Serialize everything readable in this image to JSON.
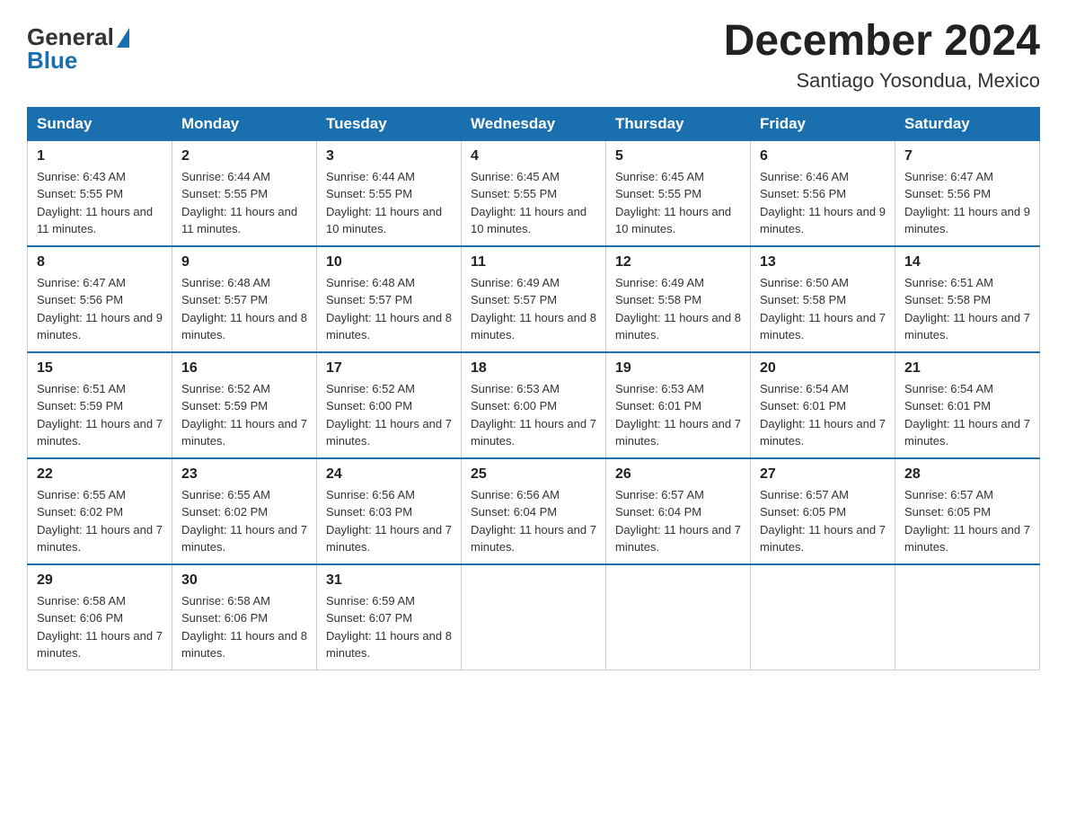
{
  "header": {
    "logo_general": "General",
    "logo_blue": "Blue",
    "month_title": "December 2024",
    "location": "Santiago Yosondua, Mexico"
  },
  "weekdays": [
    "Sunday",
    "Monday",
    "Tuesday",
    "Wednesday",
    "Thursday",
    "Friday",
    "Saturday"
  ],
  "weeks": [
    [
      {
        "day": "1",
        "sunrise": "6:43 AM",
        "sunset": "5:55 PM",
        "daylight": "11 hours and 11 minutes."
      },
      {
        "day": "2",
        "sunrise": "6:44 AM",
        "sunset": "5:55 PM",
        "daylight": "11 hours and 11 minutes."
      },
      {
        "day": "3",
        "sunrise": "6:44 AM",
        "sunset": "5:55 PM",
        "daylight": "11 hours and 10 minutes."
      },
      {
        "day": "4",
        "sunrise": "6:45 AM",
        "sunset": "5:55 PM",
        "daylight": "11 hours and 10 minutes."
      },
      {
        "day": "5",
        "sunrise": "6:45 AM",
        "sunset": "5:55 PM",
        "daylight": "11 hours and 10 minutes."
      },
      {
        "day": "6",
        "sunrise": "6:46 AM",
        "sunset": "5:56 PM",
        "daylight": "11 hours and 9 minutes."
      },
      {
        "day": "7",
        "sunrise": "6:47 AM",
        "sunset": "5:56 PM",
        "daylight": "11 hours and 9 minutes."
      }
    ],
    [
      {
        "day": "8",
        "sunrise": "6:47 AM",
        "sunset": "5:56 PM",
        "daylight": "11 hours and 9 minutes."
      },
      {
        "day": "9",
        "sunrise": "6:48 AM",
        "sunset": "5:57 PM",
        "daylight": "11 hours and 8 minutes."
      },
      {
        "day": "10",
        "sunrise": "6:48 AM",
        "sunset": "5:57 PM",
        "daylight": "11 hours and 8 minutes."
      },
      {
        "day": "11",
        "sunrise": "6:49 AM",
        "sunset": "5:57 PM",
        "daylight": "11 hours and 8 minutes."
      },
      {
        "day": "12",
        "sunrise": "6:49 AM",
        "sunset": "5:58 PM",
        "daylight": "11 hours and 8 minutes."
      },
      {
        "day": "13",
        "sunrise": "6:50 AM",
        "sunset": "5:58 PM",
        "daylight": "11 hours and 7 minutes."
      },
      {
        "day": "14",
        "sunrise": "6:51 AM",
        "sunset": "5:58 PM",
        "daylight": "11 hours and 7 minutes."
      }
    ],
    [
      {
        "day": "15",
        "sunrise": "6:51 AM",
        "sunset": "5:59 PM",
        "daylight": "11 hours and 7 minutes."
      },
      {
        "day": "16",
        "sunrise": "6:52 AM",
        "sunset": "5:59 PM",
        "daylight": "11 hours and 7 minutes."
      },
      {
        "day": "17",
        "sunrise": "6:52 AM",
        "sunset": "6:00 PM",
        "daylight": "11 hours and 7 minutes."
      },
      {
        "day": "18",
        "sunrise": "6:53 AM",
        "sunset": "6:00 PM",
        "daylight": "11 hours and 7 minutes."
      },
      {
        "day": "19",
        "sunrise": "6:53 AM",
        "sunset": "6:01 PM",
        "daylight": "11 hours and 7 minutes."
      },
      {
        "day": "20",
        "sunrise": "6:54 AM",
        "sunset": "6:01 PM",
        "daylight": "11 hours and 7 minutes."
      },
      {
        "day": "21",
        "sunrise": "6:54 AM",
        "sunset": "6:01 PM",
        "daylight": "11 hours and 7 minutes."
      }
    ],
    [
      {
        "day": "22",
        "sunrise": "6:55 AM",
        "sunset": "6:02 PM",
        "daylight": "11 hours and 7 minutes."
      },
      {
        "day": "23",
        "sunrise": "6:55 AM",
        "sunset": "6:02 PM",
        "daylight": "11 hours and 7 minutes."
      },
      {
        "day": "24",
        "sunrise": "6:56 AM",
        "sunset": "6:03 PM",
        "daylight": "11 hours and 7 minutes."
      },
      {
        "day": "25",
        "sunrise": "6:56 AM",
        "sunset": "6:04 PM",
        "daylight": "11 hours and 7 minutes."
      },
      {
        "day": "26",
        "sunrise": "6:57 AM",
        "sunset": "6:04 PM",
        "daylight": "11 hours and 7 minutes."
      },
      {
        "day": "27",
        "sunrise": "6:57 AM",
        "sunset": "6:05 PM",
        "daylight": "11 hours and 7 minutes."
      },
      {
        "day": "28",
        "sunrise": "6:57 AM",
        "sunset": "6:05 PM",
        "daylight": "11 hours and 7 minutes."
      }
    ],
    [
      {
        "day": "29",
        "sunrise": "6:58 AM",
        "sunset": "6:06 PM",
        "daylight": "11 hours and 7 minutes."
      },
      {
        "day": "30",
        "sunrise": "6:58 AM",
        "sunset": "6:06 PM",
        "daylight": "11 hours and 8 minutes."
      },
      {
        "day": "31",
        "sunrise": "6:59 AM",
        "sunset": "6:07 PM",
        "daylight": "11 hours and 8 minutes."
      },
      null,
      null,
      null,
      null
    ]
  ],
  "labels": {
    "sunrise": "Sunrise:",
    "sunset": "Sunset:",
    "daylight": "Daylight:"
  }
}
